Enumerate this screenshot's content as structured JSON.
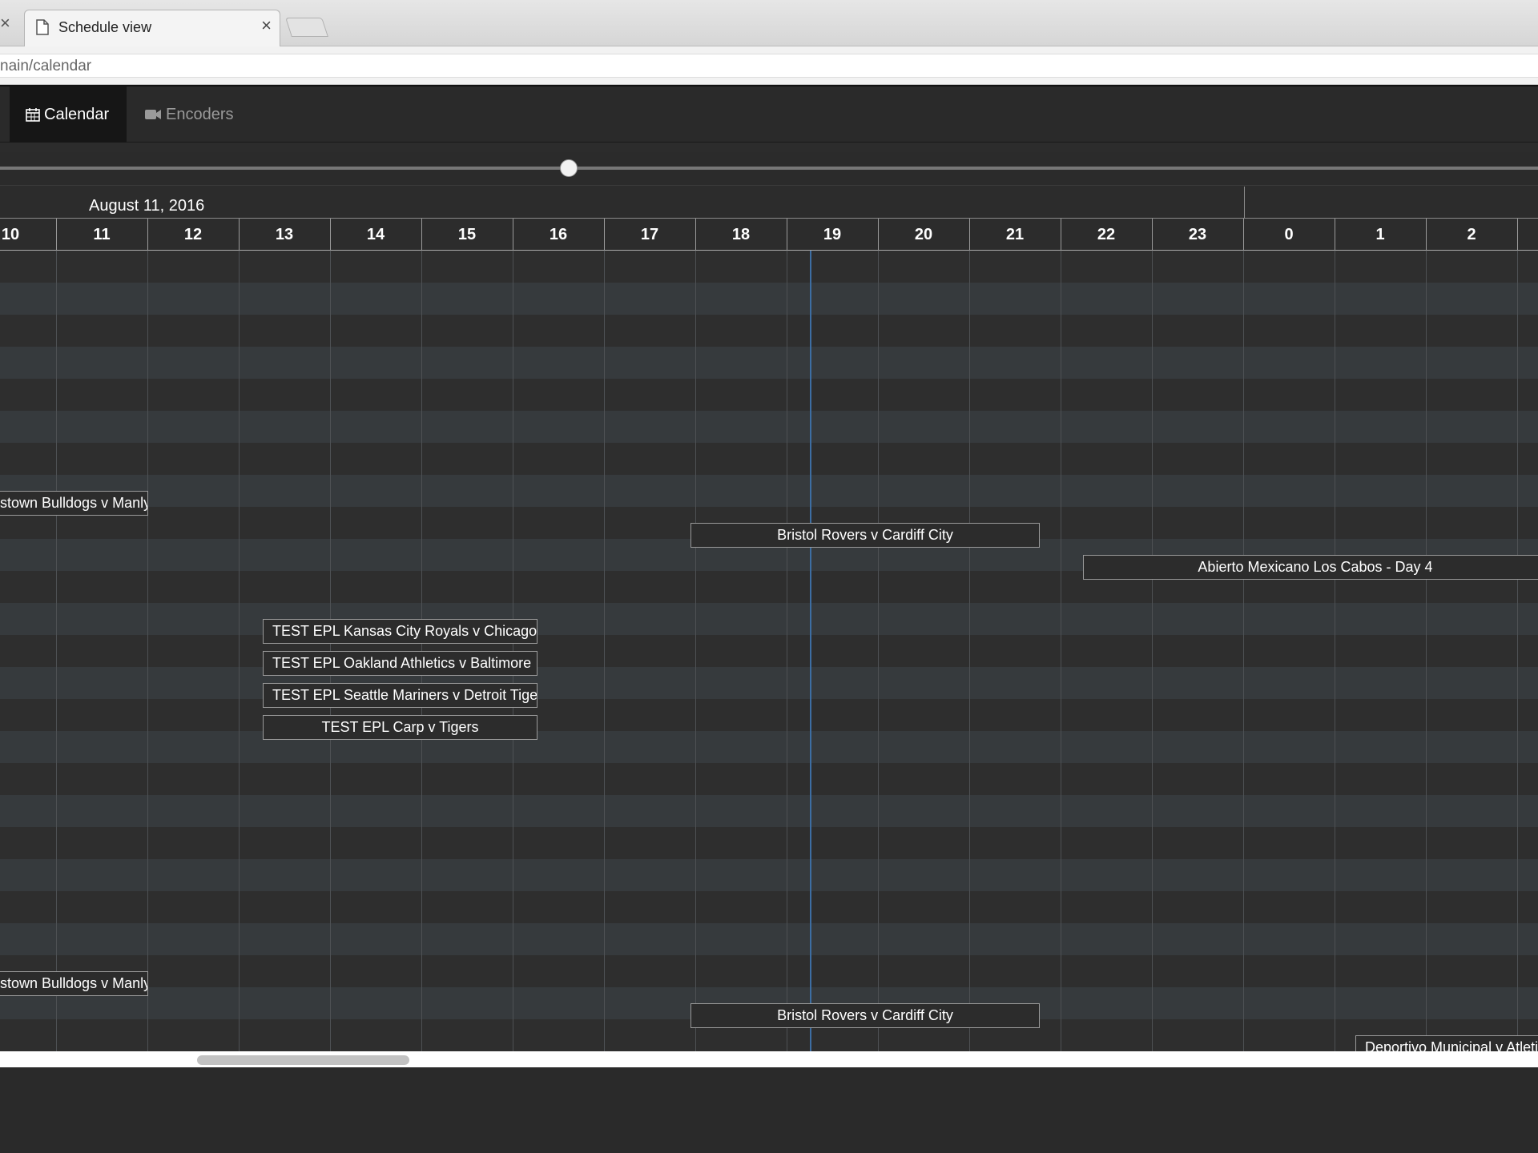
{
  "browser": {
    "tab_title": "Schedule view",
    "tab_close": "×",
    "left_close": "×",
    "url": "nain/calendar"
  },
  "nav": {
    "calendar_label": "Calendar",
    "encoders_label": "Encoders"
  },
  "timeline": {
    "date_label": "August 11, 2016",
    "hours": [
      "10",
      "11",
      "12",
      "13",
      "14",
      "15",
      "16",
      "17",
      "18",
      "19",
      "20",
      "21",
      "22",
      "23",
      "0",
      "1",
      "2"
    ]
  },
  "events": [
    {
      "label": "stown Bulldogs v Manly"
    },
    {
      "label": "Bristol Rovers v Cardiff City"
    },
    {
      "label": "Abierto Mexicano Los Cabos - Day 4"
    },
    {
      "label": "TEST EPL Kansas City Royals v Chicago"
    },
    {
      "label": "TEST EPL Oakland Athletics v Baltimore"
    },
    {
      "label": "TEST EPL Seattle Mariners v Detroit Tigers"
    },
    {
      "label": "TEST EPL Carp v Tigers"
    },
    {
      "label": "stown Bulldogs v Manly"
    },
    {
      "label": "Bristol Rovers v Cardiff City"
    },
    {
      "label": "Deportivo Municipal v Atletico"
    }
  ],
  "colors": {
    "background": "#2c2c2c",
    "band_light": "#363a3d",
    "now_line": "#3d6ea3"
  }
}
